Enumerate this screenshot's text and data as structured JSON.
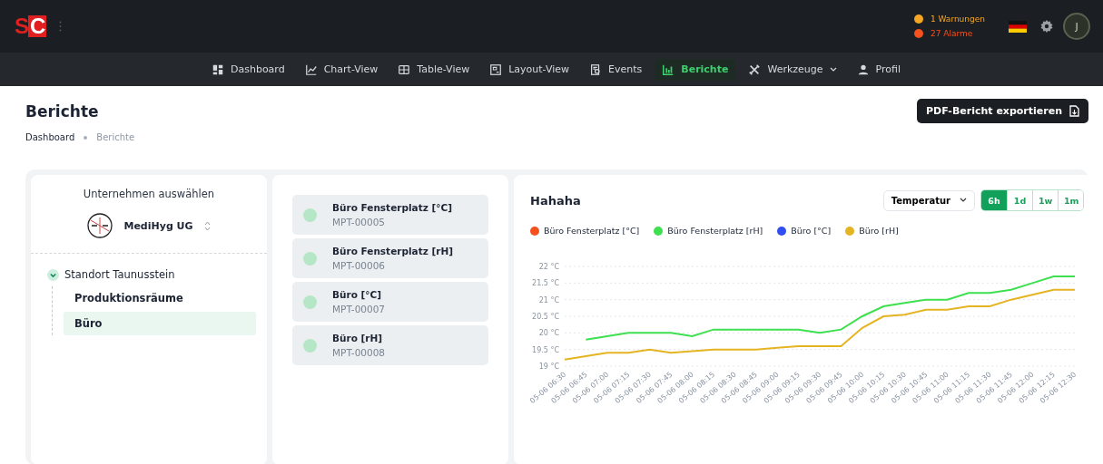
{
  "header": {
    "logo": "SC",
    "alerts": [
      {
        "label": "1 Warnungen",
        "color": "#f5a623"
      },
      {
        "label": "27 Alarme",
        "color": "#f4511e"
      }
    ],
    "avatar": "J"
  },
  "nav": [
    {
      "label": "Dashboard",
      "selected": false
    },
    {
      "label": "Chart-View",
      "selected": false
    },
    {
      "label": "Table-View",
      "selected": false
    },
    {
      "label": "Layout-View",
      "selected": false
    },
    {
      "label": "Events",
      "selected": false
    },
    {
      "label": "Berichte",
      "selected": true
    },
    {
      "label": "Werkzeuge",
      "selected": false,
      "dropdown": true
    },
    {
      "label": "Profil",
      "selected": false
    }
  ],
  "page": {
    "title": "Berichte",
    "breadcrumb": [
      {
        "label": "Dashboard",
        "selected": false
      },
      {
        "label": "Berichte",
        "selected": true
      }
    ],
    "export_button": "PDF-Bericht exportieren"
  },
  "company_panel": {
    "heading": "Unternehmen auswählen",
    "company": "MediHyg UG",
    "tree": [
      {
        "label": "Standort Taunusstein",
        "expanded": true,
        "selected": false,
        "children": [
          {
            "label": "Produktionsräume",
            "selected": false
          },
          {
            "label": "Büro",
            "selected": true
          }
        ]
      }
    ]
  },
  "sensors": [
    {
      "name": "Büro Fensterplatz [°C]",
      "id": "MPT-00005"
    },
    {
      "name": "Büro Fensterplatz [rH]",
      "id": "MPT-00006"
    },
    {
      "name": "Büro [°C]",
      "id": "MPT-00007"
    },
    {
      "name": "Büro [rH]",
      "id": "MPT-00008"
    }
  ],
  "chart_panel": {
    "title": "Hahaha",
    "metric": "Temperatur",
    "ranges": [
      {
        "label": "6h",
        "selected": true
      },
      {
        "label": "1d",
        "selected": false
      },
      {
        "label": "1w",
        "selected": false
      },
      {
        "label": "1m",
        "selected": false
      }
    ],
    "chart_data": {
      "type": "line",
      "grid": true,
      "x": [
        "05-06 06:30",
        "05-06 06:45",
        "05-06 07:00",
        "05-06 07:15",
        "05-06 07:30",
        "05-06 07:45",
        "05-06 08:00",
        "05-06 08:15",
        "05-06 08:30",
        "05-06 08:45",
        "05-06 09:00",
        "05-06 09:15",
        "05-06 09:30",
        "05-06 09:45",
        "05-06 10:00",
        "05-06 10:15",
        "05-06 10:30",
        "05-06 10:45",
        "05-06 11:00",
        "05-06 11:15",
        "05-06 11:30",
        "05-06 11:45",
        "05-06 12:00",
        "05-06 12:15",
        "05-06 12:30"
      ],
      "ylim": [
        19,
        22
      ],
      "yticks": [
        {
          "value": 19,
          "label": "19 °C"
        },
        {
          "value": 19.5,
          "label": "19.5 °C"
        },
        {
          "value": 20,
          "label": "20 °C"
        },
        {
          "value": 20.5,
          "label": "20.5 °C"
        },
        {
          "value": 21,
          "label": "21 °C"
        },
        {
          "value": 21.5,
          "label": "21.5 °C"
        },
        {
          "value": 22,
          "label": "22 °C"
        }
      ],
      "series": [
        {
          "name": "Büro Fensterplatz [°C]",
          "color": "#f4511e",
          "values": [
            null,
            null,
            null,
            null,
            null,
            null,
            null,
            null,
            null,
            null,
            null,
            null,
            null,
            null,
            null,
            null,
            null,
            null,
            null,
            null,
            null,
            null,
            null,
            null,
            null
          ]
        },
        {
          "name": "Büro Fensterplatz [rH]",
          "color": "#3ee04f",
          "values": [
            null,
            19.8,
            19.9,
            20.0,
            20.0,
            20.0,
            19.9,
            20.1,
            20.1,
            20.1,
            20.1,
            20.1,
            20.0,
            20.1,
            20.5,
            20.8,
            20.9,
            21.0,
            21.0,
            21.2,
            21.2,
            21.3,
            21.5,
            21.7,
            21.7
          ]
        },
        {
          "name": "Büro [°C]",
          "color": "#2f4ff0",
          "values": [
            null,
            null,
            null,
            null,
            null,
            null,
            null,
            null,
            null,
            null,
            null,
            null,
            null,
            null,
            null,
            null,
            null,
            null,
            null,
            null,
            null,
            null,
            null,
            null,
            null
          ]
        },
        {
          "name": "Büro [rH]",
          "color": "#e5b422",
          "values": [
            19.2,
            19.3,
            19.4,
            19.4,
            19.5,
            19.4,
            19.45,
            19.5,
            19.5,
            19.5,
            19.55,
            19.6,
            19.6,
            19.6,
            20.15,
            20.5,
            20.55,
            20.7,
            20.7,
            20.8,
            20.8,
            21.0,
            21.15,
            21.3,
            21.3
          ]
        }
      ]
    }
  }
}
